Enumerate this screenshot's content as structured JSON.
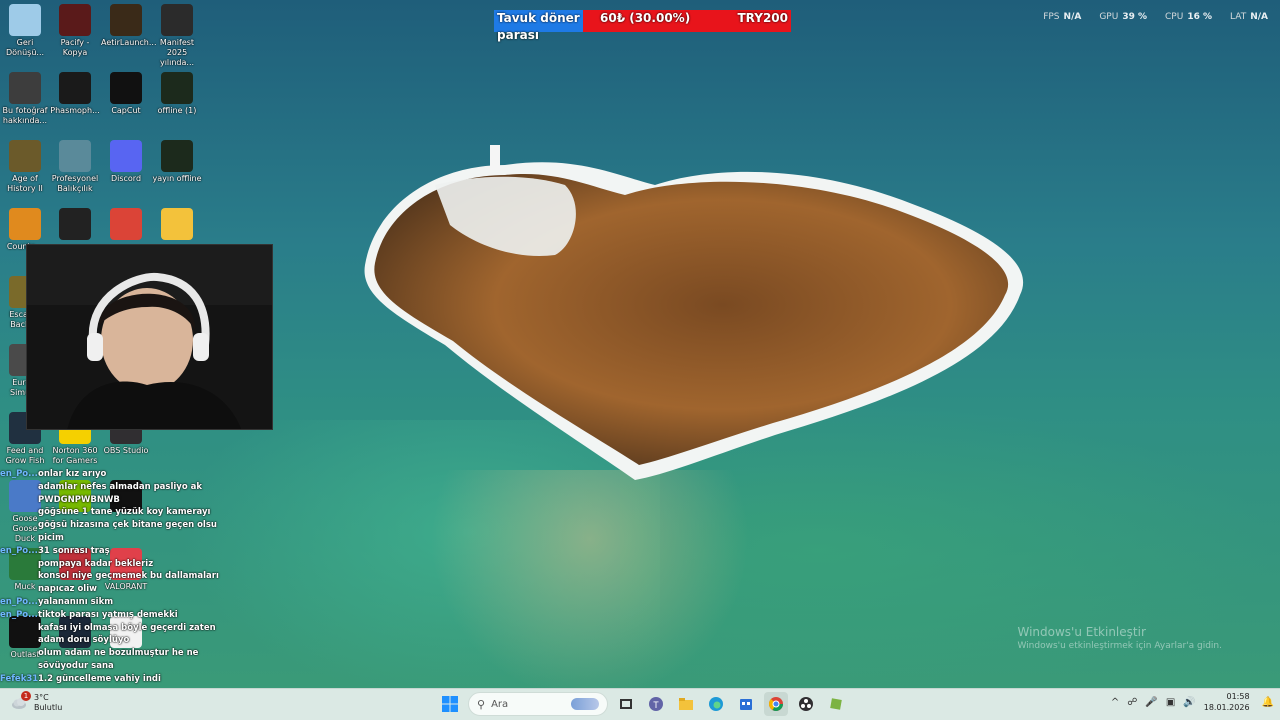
{
  "desktop_icons": [
    {
      "label": "Geri\nDönüşü...",
      "icon": "recycle-bin-icon"
    },
    {
      "label": "Pacify -\nKopya",
      "icon": "pacify-icon"
    },
    {
      "label": "AetirLaunch...",
      "icon": "aetir-launcher-icon"
    },
    {
      "label": "Manifest\n2025 yılında...",
      "icon": "manifest-icon"
    },
    {
      "label": "Bu fotoğraf\nhakkında...",
      "icon": "photo-info-icon"
    },
    {
      "label": "Phasmoph...",
      "icon": "phasmophobia-icon"
    },
    {
      "label": "CapCut",
      "icon": "capcut-icon"
    },
    {
      "label": "offline (1)",
      "icon": "offline-file-icon"
    },
    {
      "label": "Age of\nHistory II",
      "icon": "age-of-history-icon"
    },
    {
      "label": "Profesyonel\nBalıkçılık",
      "icon": "fishing-game-icon"
    },
    {
      "label": "Discord",
      "icon": "discord-icon"
    },
    {
      "label": "yayın offline",
      "icon": "stream-offline-file-icon"
    },
    {
      "label": "Counte...",
      "icon": "counter-strike-icon"
    },
    {
      "label": "",
      "icon": "cat-game-icon"
    },
    {
      "label": "",
      "icon": "chrome-icon"
    },
    {
      "label": "",
      "icon": "folder-icon"
    },
    {
      "label": "Escap...\nBackr...",
      "icon": "escape-game-icon"
    },
    {
      "label": "Euro...\nSimul...",
      "icon": "euro-truck-icon"
    },
    {
      "label": "Feed and\nGrow Fish",
      "icon": "feed-grow-fish-icon"
    },
    {
      "label": "Norton 360\nfor Gamers",
      "icon": "norton-icon"
    },
    {
      "label": "OBS Studio",
      "icon": "obs-icon"
    },
    {
      "label": "Goose Goose\nDuck",
      "icon": "goose-duck-icon"
    },
    {
      "label": "",
      "icon": "nvidia-icon"
    },
    {
      "label": "",
      "icon": "rave-icon"
    },
    {
      "label": "Muck",
      "icon": "muck-icon"
    },
    {
      "label": "",
      "icon": "app-icon"
    },
    {
      "label": "VALORANT",
      "icon": "valorant-icon"
    },
    {
      "label": "Outlast",
      "icon": "outlast-icon"
    },
    {
      "label": "",
      "icon": "steam-icon"
    },
    {
      "label": "",
      "icon": "text-file-icon"
    }
  ],
  "donation": {
    "title": "Tavuk döner",
    "title_line2": "parası",
    "amount": "60₺ (30.00%)",
    "goal": "TRY200",
    "progress_fraction": 0.3,
    "fill_color": "#1e7ae6",
    "bg_color": "#e8141b"
  },
  "perf": [
    {
      "key": "FPS",
      "value": "N/A"
    },
    {
      "key": "GPU",
      "value": "39 %"
    },
    {
      "key": "CPU",
      "value": "16 %"
    },
    {
      "key": "LAT",
      "value": "N/A"
    }
  ],
  "chat": [
    {
      "user": "en_Po...",
      "msg": "onlar kız arıyo"
    },
    {
      "user": "",
      "msg": "adamlar nefes almadan pasliyo ak PWDGNPWBNWB"
    },
    {
      "user": "",
      "msg": "göğsüne 1 tane yüzük koy kamerayı göğsü hizasına çek bitane geçen olsu picim"
    },
    {
      "user": "en_Po...",
      "msg": "31 sonrası traş"
    },
    {
      "user": "",
      "msg": "pompaya kadar bekleriz"
    },
    {
      "user": "",
      "msg": "konsol niye geçmemek bu dallamaları napıcaz oliw"
    },
    {
      "user": "en_Po...",
      "msg": "yalananını sikm"
    },
    {
      "user": "en_Po...",
      "msg": "tiktok parası yatmış demekki"
    },
    {
      "user": "",
      "msg": "kafası iyi olmasa böyle geçerdi zaten adam doru söylüyo"
    },
    {
      "user": "",
      "msg": "olum adam ne bozulmuştur he ne sövüyodur sana"
    },
    {
      "user": "Fefek31",
      "msg": "1.2 güncelleme vahiy indi"
    }
  ],
  "watermark": {
    "line1": "Windows'u Etkinleştir",
    "line2": "Windows'u etkinleştirmek için Ayarlar'a gidin."
  },
  "taskbar": {
    "weather_temp": "3°C",
    "weather_desc": "Bulutlu",
    "weather_badge": "1",
    "search_placeholder": "Ara",
    "apps": [
      "start-icon",
      "search-icon",
      "widgets-icon",
      "task-view-icon",
      "teams-icon",
      "file-explorer-icon",
      "edge-icon",
      "store-icon",
      "chrome-icon",
      "obs-icon",
      "game-icon"
    ],
    "time": "01:58",
    "date": "18.01.2026"
  }
}
